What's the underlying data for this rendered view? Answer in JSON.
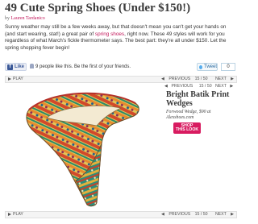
{
  "article": {
    "title": "49 Cute Spring Shoes (Under $150!)",
    "byline_prefix": "by",
    "author": "Lauren Tardanico",
    "intro_part1": "Sunny weather may still be a few weeks away, but that doesn't mean you can't get your hands on (and start wearing, stat!) a great pair of ",
    "intro_link": "spring shoes",
    "intro_part2": ", right now. These 49 styles will work for you regardless of what March's fickle thermometer says. The best part: they're all under $150. Let the spring shopping fever begin!"
  },
  "social": {
    "like_label": "Like",
    "like_text": "9 people like this. Be the first of your friends.",
    "tweet_label": "Tweet",
    "tweet_count": "0"
  },
  "gallery": {
    "play_label": "PLAY",
    "prev_label": "PREVIOUS",
    "next_label": "NEXT",
    "counter": "15 / 50",
    "item": {
      "title": "Bright Batik Print Wedges",
      "description": "Forwood Wedge, $90 at Alexshoes.com",
      "shop_label_line1": "SHOP",
      "shop_label_line2": "THIS LOOK"
    }
  },
  "colors": {
    "accent": "#d81b60",
    "title": "#3a3a3a",
    "facebook": "#3b5998"
  }
}
